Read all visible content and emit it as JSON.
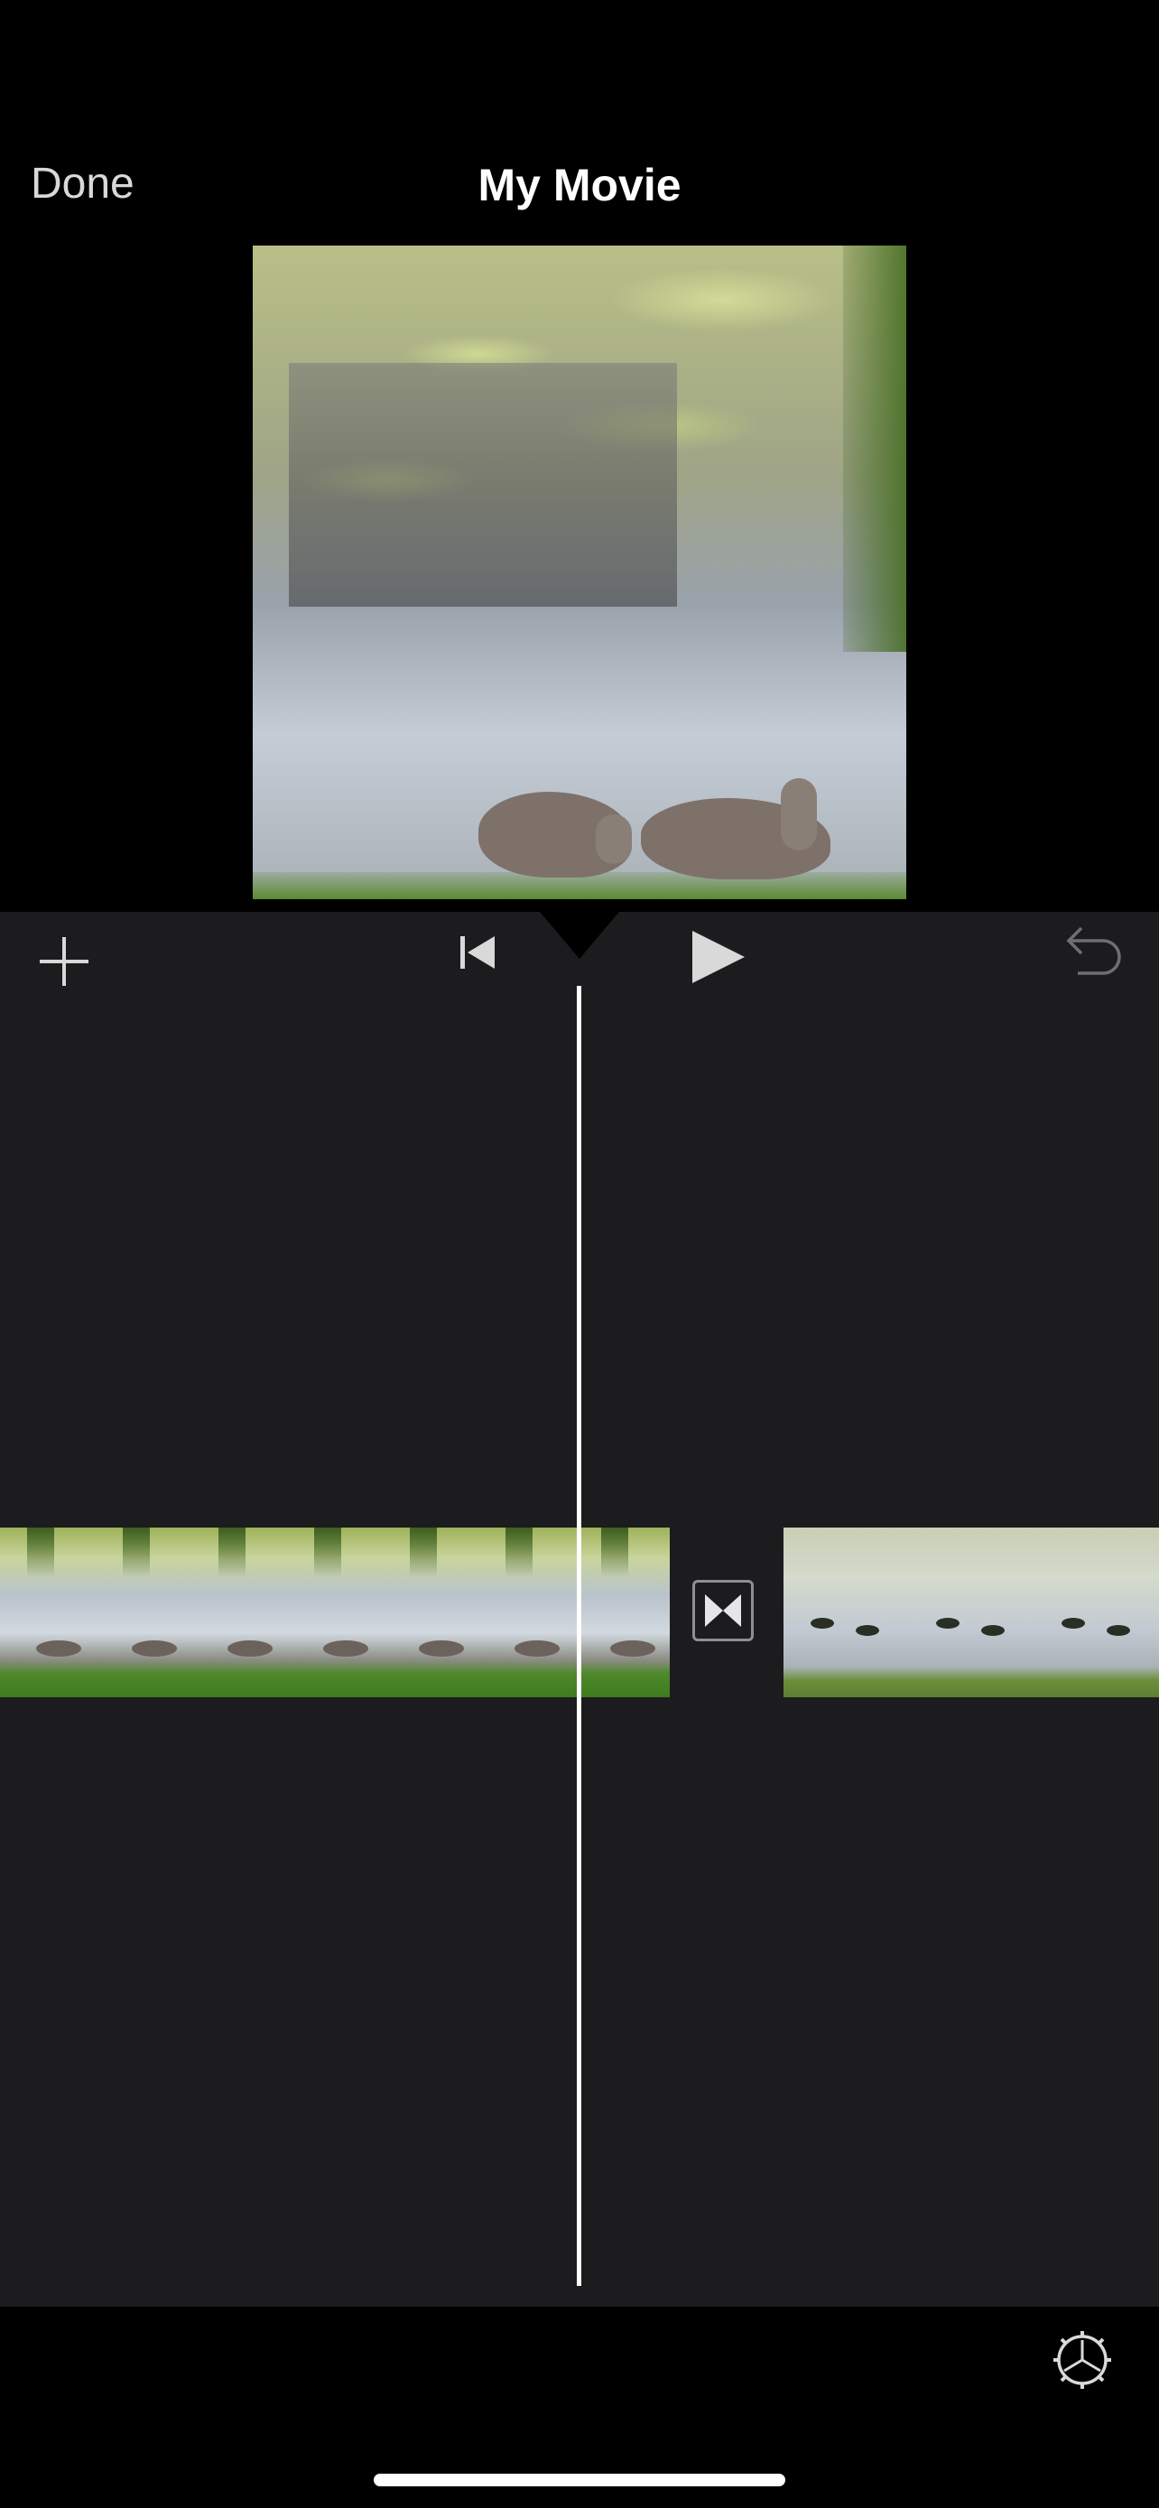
{
  "nav": {
    "done_label": "Done",
    "title": "My Movie"
  },
  "toolbar": {
    "add_icon": "plus-icon",
    "rewind_icon": "skip-to-start-icon",
    "play_icon": "play-icon",
    "undo_icon": "undo-icon"
  },
  "timeline": {
    "clips": [
      {
        "name": "clip-swans",
        "frames": 7
      },
      {
        "name": "clip-pond",
        "frames": 3
      }
    ],
    "transition_icon": "bowtie-transition-icon"
  },
  "bottom": {
    "settings_icon": "gear-icon"
  },
  "colors": {
    "background": "#000000",
    "editor_bg": "#1c1c1e",
    "text_primary": "#ffffff",
    "text_secondary": "#d9d9d9",
    "icon_gray": "#8e8e93"
  }
}
